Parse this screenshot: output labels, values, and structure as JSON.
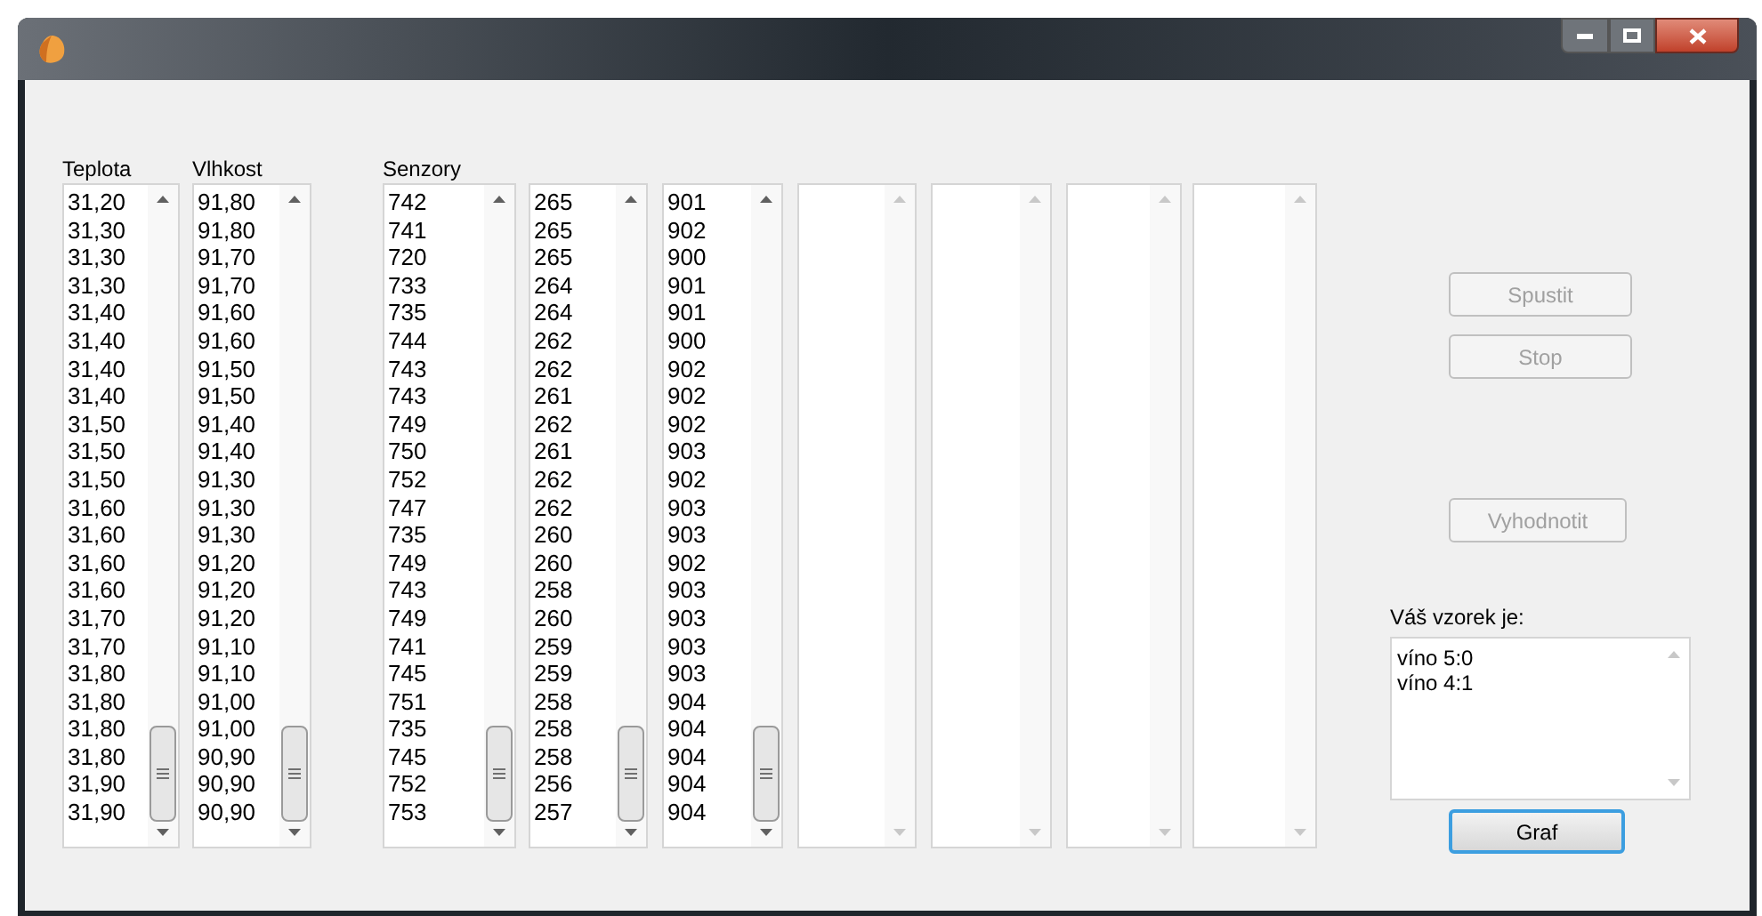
{
  "lists": [
    {
      "label": "Teplota",
      "items": [
        "31,20",
        "31,30",
        "31,30",
        "31,30",
        "31,40",
        "31,40",
        "31,40",
        "31,40",
        "31,50",
        "31,50",
        "31,50",
        "31,60",
        "31,60",
        "31,60",
        "31,60",
        "31,70",
        "31,70",
        "31,80",
        "31,80",
        "31,80",
        "31,80",
        "31,90",
        "31,90"
      ]
    },
    {
      "label": "Vlhkost",
      "items": [
        "91,80",
        "91,80",
        "91,70",
        "91,70",
        "91,60",
        "91,60",
        "91,50",
        "91,50",
        "91,40",
        "91,40",
        "91,30",
        "91,30",
        "91,30",
        "91,20",
        "91,20",
        "91,20",
        "91,10",
        "91,10",
        "91,00",
        "91,00",
        "90,90",
        "90,90",
        "90,90"
      ]
    },
    {
      "label": "Senzory",
      "items": [
        "742",
        "741",
        "720",
        "733",
        "735",
        "744",
        "743",
        "743",
        "749",
        "750",
        "752",
        "747",
        "735",
        "749",
        "743",
        "749",
        "741",
        "745",
        "751",
        "735",
        "745",
        "752",
        "753"
      ]
    },
    {
      "items": [
        "265",
        "265",
        "265",
        "264",
        "264",
        "262",
        "262",
        "261",
        "262",
        "261",
        "262",
        "262",
        "260",
        "260",
        "258",
        "260",
        "259",
        "259",
        "258",
        "258",
        "258",
        "256",
        "257"
      ]
    },
    {
      "items": [
        "901",
        "902",
        "900",
        "901",
        "901",
        "900",
        "902",
        "902",
        "902",
        "903",
        "902",
        "903",
        "903",
        "902",
        "903",
        "903",
        "903",
        "903",
        "904",
        "904",
        "904",
        "904",
        "904"
      ]
    },
    {
      "kind": "empty"
    },
    {
      "kind": "empty"
    },
    {
      "kind": "empty"
    },
    {
      "kind": "empty"
    }
  ],
  "buttons": [
    {
      "label": "Spustit",
      "disabled": true
    },
    {
      "label": "Stop",
      "disabled": true
    },
    {
      "label": "Vyhodnotit",
      "disabled": true
    }
  ],
  "result": {
    "label": "Váš vzorek je:",
    "lines": [
      "víno 5:0",
      "víno 4:1"
    ]
  },
  "graph_button": {
    "label": "Graf",
    "disabled": false
  }
}
